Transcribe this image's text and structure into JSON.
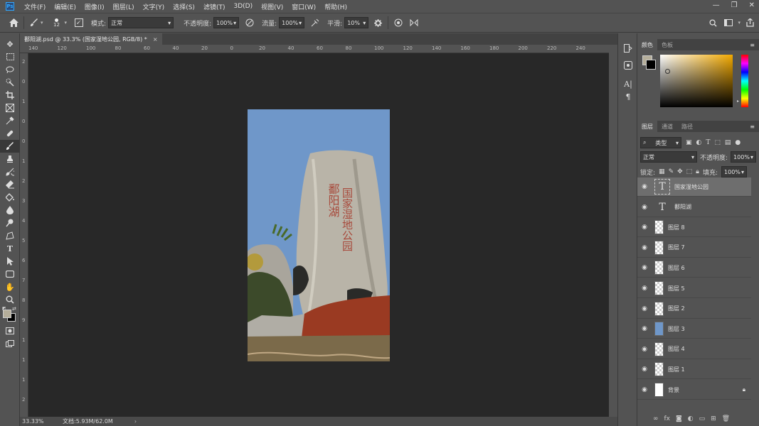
{
  "menubar": {
    "logo": "Ps",
    "items": [
      "文件(F)",
      "编辑(E)",
      "图像(I)",
      "图层(L)",
      "文字(Y)",
      "选择(S)",
      "滤镜(T)",
      "3D(D)",
      "视图(V)",
      "窗口(W)",
      "帮助(H)"
    ],
    "window_controls": [
      "—",
      "❐",
      "✕"
    ]
  },
  "options": {
    "brush_size": "12",
    "mode_label": "模式:",
    "mode_value": "正常",
    "opacity_label": "不透明度:",
    "opacity_value": "100%",
    "flow_label": "流量:",
    "flow_value": "100%",
    "smooth_label": "平滑:",
    "smooth_value": "10%"
  },
  "document": {
    "tab_title": "鄱阳湖.psd @ 33.3% (国家湿地公园, RGB/8) *",
    "tab_close": "×"
  },
  "rulers": {
    "h": [
      "140",
      "120",
      "100",
      "80",
      "60",
      "40",
      "20",
      "0",
      "20",
      "40",
      "60",
      "80",
      "100",
      "120",
      "140",
      "160",
      "180",
      "200",
      "220",
      "240"
    ],
    "v": [
      "2",
      "0",
      "1",
      "0",
      "0",
      "1",
      "2",
      "3",
      "4",
      "5",
      "6",
      "7",
      "8",
      "9",
      "1",
      "1",
      "1",
      "2"
    ]
  },
  "status": {
    "zoom": "33.33%",
    "doc_info": "文档:5.93M/62.0M",
    "arrow": "›"
  },
  "color_panel": {
    "tabs": [
      "颜色",
      "色板"
    ],
    "fg_color": "#b5ae9a",
    "bg_color": "#000000",
    "hue_base": "#f2a900"
  },
  "layers_panel": {
    "tabs": [
      "图层",
      "通道",
      "路径"
    ],
    "filter_label": "类型",
    "blend_mode": "正常",
    "opacity_label": "不透明度:",
    "opacity_value": "100%",
    "lock_label": "锁定:",
    "fill_label": "填充:",
    "fill_value": "100%"
  },
  "layers": [
    {
      "name": "国家湿地公园",
      "kind": "text",
      "selected": true
    },
    {
      "name": "鄱阳湖",
      "kind": "text"
    },
    {
      "name": "图层 8",
      "kind": "pixel"
    },
    {
      "name": "图层 7",
      "kind": "pixel"
    },
    {
      "name": "图层 6",
      "kind": "pixel"
    },
    {
      "name": "图层 5",
      "kind": "pixel"
    },
    {
      "name": "图层 2",
      "kind": "pixel"
    },
    {
      "name": "图层 3",
      "kind": "pixel",
      "thumb": "#6f97c9"
    },
    {
      "name": "图层 4",
      "kind": "pixel"
    },
    {
      "name": "图层 1",
      "kind": "pixel"
    },
    {
      "name": "背景",
      "kind": "background",
      "locked": true
    }
  ],
  "artwork": {
    "title_vertical": "鄱阳湖",
    "subtitle_vertical": "国家湿地公园",
    "sky_color": "#6f97c9",
    "stone_color": "#b9b4a8",
    "ground_color": "#9a3a22"
  }
}
